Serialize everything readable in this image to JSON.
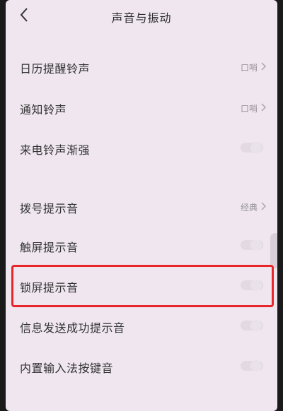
{
  "header": {
    "title": "声音与振动"
  },
  "rows": [
    {
      "label": "日历提醒铃声",
      "value": "口哨",
      "type": "link"
    },
    {
      "label": "通知铃声",
      "value": "口哨",
      "type": "link"
    },
    {
      "label": "来电铃声渐强",
      "type": "toggle",
      "on": false
    },
    {
      "label": "拨号提示音",
      "value": "经典",
      "type": "link"
    },
    {
      "label": "触屏提示音",
      "type": "toggle",
      "on": false
    },
    {
      "label": "锁屏提示音",
      "type": "toggle",
      "on": false
    },
    {
      "label": "信息发送成功提示音",
      "type": "toggle",
      "on": false
    },
    {
      "label": "内置输入法按键音",
      "type": "toggle",
      "on": false
    }
  ],
  "colors": {
    "background": "#efe6ef",
    "highlight": "#e8262a",
    "text": "#333333",
    "secondary_text": "#9a949c"
  },
  "icons": {
    "back": "chevron-left-icon",
    "row_arrow": "chevron-right-icon"
  }
}
